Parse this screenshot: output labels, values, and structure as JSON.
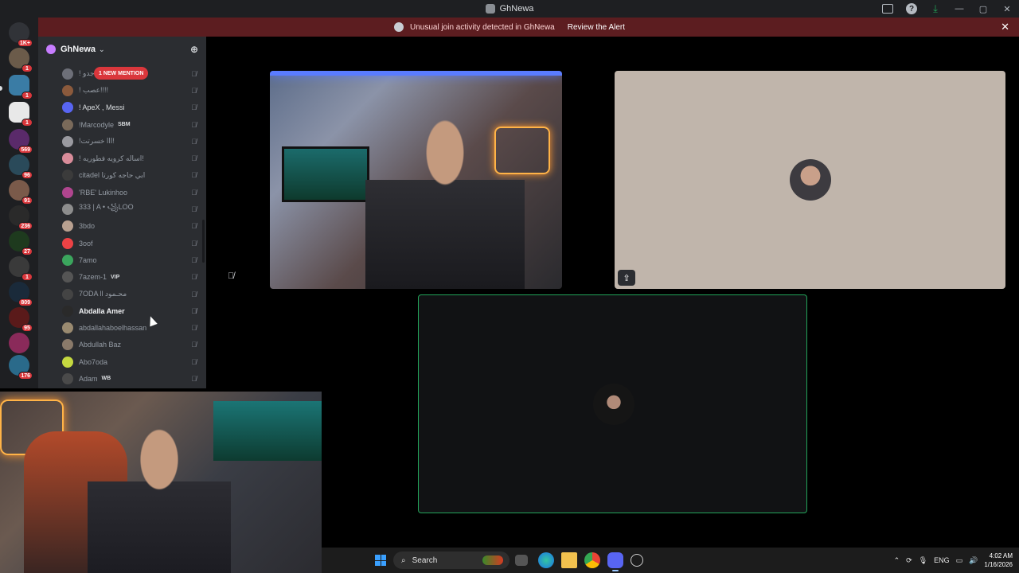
{
  "window": {
    "title": "GhNewa"
  },
  "alert": {
    "message": "Unusual join activity detected in GhNewa",
    "action": "Review the Alert",
    "close": "✕"
  },
  "rail": {
    "home_badge": "1K+",
    "badges": [
      "1",
      "1",
      "1",
      "569",
      "96",
      "91",
      "236",
      "27",
      "1",
      "809",
      "95",
      "176"
    ]
  },
  "guild": {
    "name": "GhNewa",
    "mention_pill": "1 NEW MENTION"
  },
  "members": [
    {
      "name": "! جدو",
      "tag": "",
      "color": "#6d6f78"
    },
    {
      "name": "! عصب!!!!",
      "tag": "",
      "color": "#8b5a3c"
    },
    {
      "name": "! ApeX , Messi",
      "tag": "",
      "color": "#5865f2",
      "bold": true
    },
    {
      "name": "!Marcodyle",
      "tag": "SBM",
      "color": "#7a6a5a"
    },
    {
      "name": "!ااا خسرتت!",
      "tag": "",
      "color": "#9a9aa0"
    },
    {
      "name": "! اساله كرويه فطوريه!",
      "tag": "",
      "color": "#d98c9a"
    },
    {
      "name": "citadel ابي حاجه كورتا",
      "tag": "",
      "color": "#3b3b3b"
    },
    {
      "name": "'RBE' Lukinhoo",
      "tag": "",
      "color": "#b0458f"
    },
    {
      "name": "333 | A • ꧁LOO",
      "tag": "",
      "color": "#8d8d8d"
    },
    {
      "name": "3bdo",
      "tag": "",
      "color": "#b8a090"
    },
    {
      "name": "3oof",
      "tag": "",
      "color": "#ed4245"
    },
    {
      "name": "7amo",
      "tag": "",
      "color": "#3ba55d"
    },
    {
      "name": "7azem-1",
      "tag": "VIP",
      "color": "#555"
    },
    {
      "name": "7ODA ll محـمود",
      "tag": "",
      "color": "#444"
    },
    {
      "name": "Abdalla Amer",
      "tag": "",
      "color": "#2a2a2a",
      "highlight": true
    },
    {
      "name": "abdallahaboelhassan",
      "tag": "",
      "color": "#9a8a70"
    },
    {
      "name": "Abdullah Baz",
      "tag": "",
      "color": "#8a7a6a"
    },
    {
      "name": "Abo7oda",
      "tag": "",
      "color": "#c5d940"
    },
    {
      "name": "Adam",
      "tag": "WB",
      "color": "#4a4a4a"
    }
  ],
  "taskbar": {
    "search_placeholder": "Search",
    "language": "ENG",
    "time": "4:02 AM",
    "date": "1/16/2026"
  },
  "icons": {
    "mute": "🎙̸",
    "screenshare": "⇪"
  }
}
